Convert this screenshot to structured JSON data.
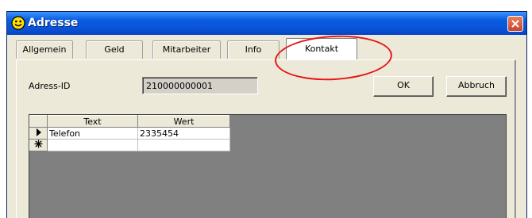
{
  "window": {
    "title": "Adresse"
  },
  "colors": {
    "titlebar": "#0a5de0",
    "annotation": "#e41818",
    "tab_active": "#ffffff"
  },
  "tabs": [
    {
      "label": "Allgemein",
      "active": false
    },
    {
      "label": "Geld",
      "active": false
    },
    {
      "label": "Mitarbeiter",
      "active": false
    },
    {
      "label": "Info",
      "active": false
    },
    {
      "label": "Kontakt",
      "active": true
    }
  ],
  "form": {
    "id_label": "Adress-ID",
    "id_value": "210000000001"
  },
  "buttons": {
    "ok": "OK",
    "cancel": "Abbruch"
  },
  "grid": {
    "columns": [
      "Text",
      "Wert"
    ],
    "rows": [
      {
        "indicator": "current-row-icon",
        "text": "Telefon",
        "wert": "2335454"
      },
      {
        "indicator": "new-row-icon",
        "text": "",
        "wert": ""
      }
    ]
  }
}
